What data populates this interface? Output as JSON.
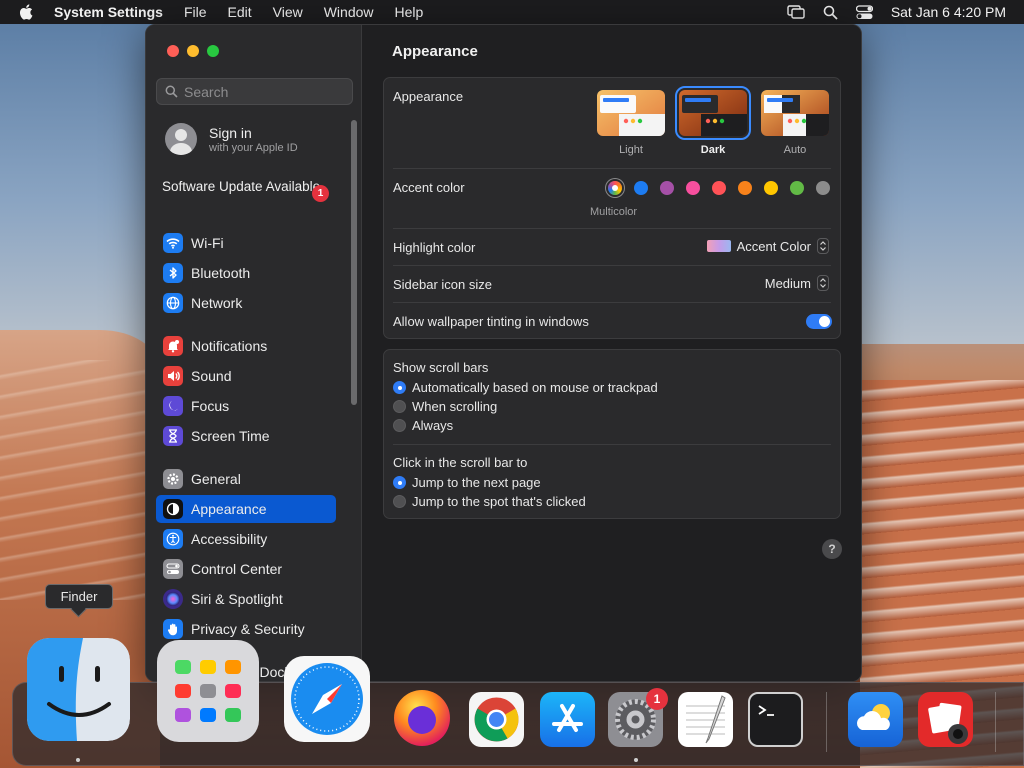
{
  "menubar": {
    "app_name": "System Settings",
    "menus": [
      "File",
      "Edit",
      "View",
      "Window",
      "Help"
    ],
    "clock": "Sat Jan 6  4:20 PM"
  },
  "sidebar": {
    "search_placeholder": "Search",
    "signin_title": "Sign in",
    "signin_subtitle": "with your Apple ID",
    "update_label": "Software Update Available",
    "update_badge": "1",
    "items": [
      {
        "label": "Wi-Fi",
        "icon": "wifi-icon",
        "color": "#1d7cf2"
      },
      {
        "label": "Bluetooth",
        "icon": "bluetooth-icon",
        "color": "#1d7cf2"
      },
      {
        "label": "Network",
        "icon": "globe-icon",
        "color": "#1d7cf2"
      },
      {
        "label": "Notifications",
        "icon": "bell-icon",
        "color": "#e8413c"
      },
      {
        "label": "Sound",
        "icon": "speaker-icon",
        "color": "#e8413c"
      },
      {
        "label": "Focus",
        "icon": "moon-icon",
        "color": "#5e4ad6"
      },
      {
        "label": "Screen Time",
        "icon": "hourglass-icon",
        "color": "#5e4ad6"
      },
      {
        "label": "General",
        "icon": "gear-icon",
        "color": "#8e8e93"
      },
      {
        "label": "Appearance",
        "icon": "appearance-icon",
        "color": "#111111"
      },
      {
        "label": "Accessibility",
        "icon": "accessibility-icon",
        "color": "#1d7cf2"
      },
      {
        "label": "Control Center",
        "icon": "control-center-icon",
        "color": "#8e8e93"
      },
      {
        "label": "Siri & Spotlight",
        "icon": "siri-icon",
        "color": "#3b2a8a"
      },
      {
        "label": "Privacy & Security",
        "icon": "hand-icon",
        "color": "#1d7cf2"
      },
      {
        "label": "Desktop & Dock",
        "icon": "dock-icon",
        "color": "#111111"
      }
    ],
    "active_item": "Appearance"
  },
  "main": {
    "title": "Appearance",
    "appearance_label": "Appearance",
    "themes": [
      {
        "label": "Light",
        "selected": false
      },
      {
        "label": "Dark",
        "selected": true
      },
      {
        "label": "Auto",
        "selected": false
      }
    ],
    "accent_label": "Accent color",
    "accent_selected_label": "Multicolor",
    "accent_colors": [
      "#1d7cf2",
      "#a550a7",
      "#f74f9e",
      "#ff5257",
      "#f7821b",
      "#ffc600",
      "#62ba46",
      "#8c8c8c"
    ],
    "highlight_label": "Highlight color",
    "highlight_value": "Accent Color",
    "sidebar_icon_label": "Sidebar icon size",
    "sidebar_icon_value": "Medium",
    "tinting_label": "Allow wallpaper tinting in windows",
    "tinting_on": true,
    "scrollbars_label": "Show scroll bars",
    "scrollbar_options": [
      {
        "label": "Automatically based on mouse or trackpad",
        "selected": true
      },
      {
        "label": "When scrolling",
        "selected": false
      },
      {
        "label": "Always",
        "selected": false
      }
    ],
    "click_label": "Click in the scroll bar to",
    "click_options": [
      {
        "label": "Jump to the next page",
        "selected": true
      },
      {
        "label": "Jump to the spot that's clicked",
        "selected": false
      }
    ],
    "help": "?"
  },
  "tooltip": "Finder",
  "dock": {
    "apps": [
      "Finder",
      "Launchpad",
      "Safari",
      "Firefox",
      "Chrome",
      "App Store",
      "System Settings",
      "TextEdit",
      "Terminal",
      "Weather",
      "Photo Booth"
    ],
    "settings_badge": "1"
  }
}
